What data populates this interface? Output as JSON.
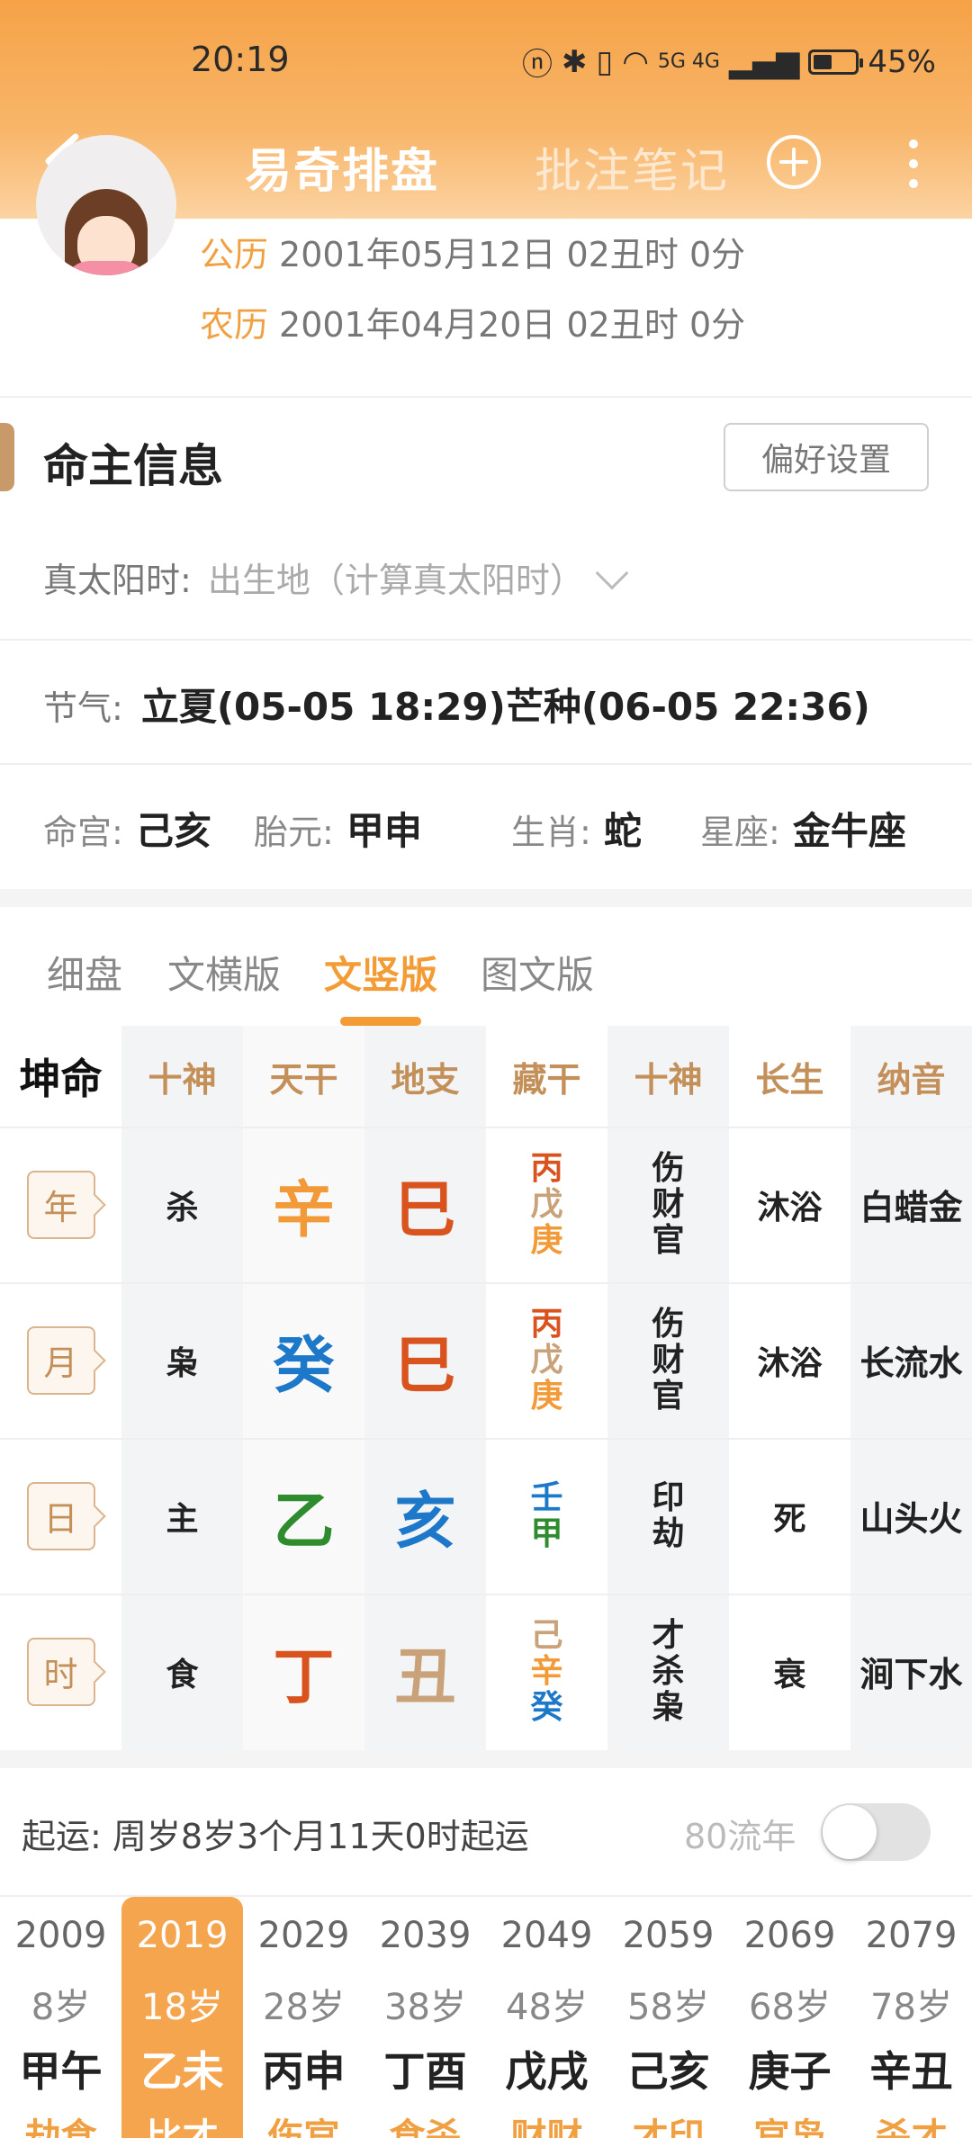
{
  "status_bar": {
    "time": "20:19",
    "network": "5G 4G",
    "battery": "45%"
  },
  "nav": {
    "title": "易奇排盘",
    "notes": "批注笔记"
  },
  "profile": {
    "solar_label": "公历",
    "solar_value": "2001年05月12日 02丑时 0分",
    "lunar_label": "农历",
    "lunar_value": "2001年04月20日 02丑时 0分"
  },
  "owner": {
    "title": "命主信息",
    "pref_button": "偏好设置",
    "solar_time_label": "真太阳时:",
    "solar_time_value": "出生地（计算真太阳时）",
    "terms_label": "节气:",
    "terms_value": "立夏(05-05 18:29)芒种(06-05 22:36)",
    "ming_gong_label": "命宫:",
    "ming_gong": "己亥",
    "tai_yuan_label": "胎元:",
    "tai_yuan": "甲申",
    "zodiac_label": "生肖:",
    "zodiac": "蛇",
    "constellation_label": "星座:",
    "constellation": "金牛座"
  },
  "tabs": [
    "细盘",
    "文横版",
    "文竖版",
    "图文版"
  ],
  "table": {
    "headers": [
      "坤命",
      "十神",
      "天干",
      "地支",
      "藏干",
      "十神",
      "长生",
      "纳音"
    ],
    "rows": [
      {
        "pillar": "年",
        "shishen": "杀",
        "gan": "辛",
        "gan_color": "#f29a38",
        "zhi": "巳",
        "zhi_color": "#d9531e",
        "canggan": [
          {
            "t": "丙",
            "c": "#d9531e"
          },
          {
            "t": "戊",
            "c": "#c9a27a"
          },
          {
            "t": "庚",
            "c": "#f29a38"
          }
        ],
        "shishen2": [
          "伤",
          "财",
          "官"
        ],
        "changsheng": "沐浴",
        "nayin": "白蜡金"
      },
      {
        "pillar": "月",
        "shishen": "枭",
        "gan": "癸",
        "gan_color": "#1d78c9",
        "zhi": "巳",
        "zhi_color": "#d9531e",
        "canggan": [
          {
            "t": "丙",
            "c": "#d9531e"
          },
          {
            "t": "戊",
            "c": "#c9a27a"
          },
          {
            "t": "庚",
            "c": "#f29a38"
          }
        ],
        "shishen2": [
          "伤",
          "财",
          "官"
        ],
        "changsheng": "沐浴",
        "nayin": "长流水"
      },
      {
        "pillar": "日",
        "shishen": "主",
        "gan": "乙",
        "gan_color": "#2e8b2e",
        "zhi": "亥",
        "zhi_color": "#1d78c9",
        "canggan": [
          {
            "t": "壬",
            "c": "#1d78c9"
          },
          {
            "t": "甲",
            "c": "#2e8b2e"
          }
        ],
        "shishen2": [
          "印",
          "劫"
        ],
        "changsheng": "死",
        "nayin": "山头火"
      },
      {
        "pillar": "时",
        "shishen": "食",
        "gan": "丁",
        "gan_color": "#d9531e",
        "zhi": "丑",
        "zhi_color": "#c9a27a",
        "canggan": [
          {
            "t": "己",
            "c": "#c9a27a"
          },
          {
            "t": "辛",
            "c": "#f29a38"
          },
          {
            "t": "癸",
            "c": "#1d78c9"
          }
        ],
        "shishen2": [
          "才",
          "杀",
          "枭"
        ],
        "changsheng": "衰",
        "nayin": "涧下水"
      }
    ]
  },
  "luck": {
    "start_label": "起运:",
    "start_value": "周岁8岁3个月11天0时起运",
    "liunian_label": "80流年",
    "liunian_on": false
  },
  "dayun": [
    {
      "year": "2009",
      "age": "8岁",
      "gz": "甲午",
      "sh": "劫食"
    },
    {
      "year": "2019",
      "age": "18岁",
      "gz": "乙未",
      "sh": "比才",
      "active": true
    },
    {
      "year": "2029",
      "age": "28岁",
      "gz": "丙申",
      "sh": "伤官"
    },
    {
      "year": "2039",
      "age": "38岁",
      "gz": "丁酉",
      "sh": "食杀"
    },
    {
      "year": "2049",
      "age": "48岁",
      "gz": "戊戌",
      "sh": "财财"
    },
    {
      "year": "2059",
      "age": "58岁",
      "gz": "己亥",
      "sh": "才印"
    },
    {
      "year": "2069",
      "age": "68岁",
      "gz": "庚子",
      "sh": "官枭"
    },
    {
      "year": "2079",
      "age": "78岁",
      "gz": "辛丑",
      "sh": "杀才"
    }
  ]
}
